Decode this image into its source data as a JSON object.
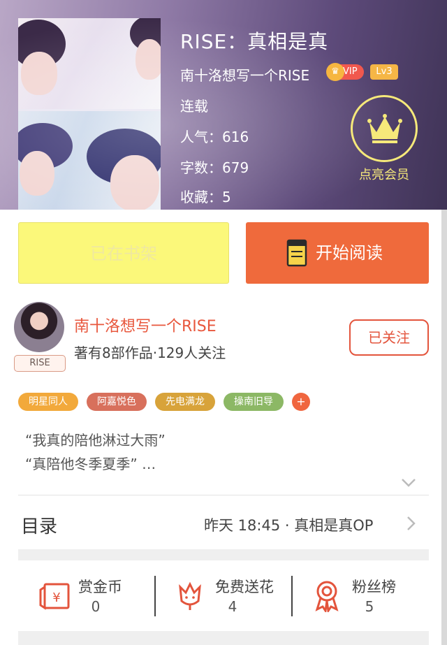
{
  "book": {
    "title": "RISE：真相是真",
    "author": "南十洛想写一个RISE",
    "vip_label": "VIP",
    "vip_crown": "♛",
    "level": "Lv3",
    "status": "连载",
    "popularity": "人气：616",
    "word_count": "字数：679",
    "favorites": "收藏：5",
    "member_label": "点亮会员"
  },
  "actions": {
    "shelf_label": "已在书架",
    "read_label": "开始阅读"
  },
  "author_card": {
    "name": "南十洛想写一个RISE",
    "stats": "著有8部作品·129人关注",
    "avatar_tag": "RISE",
    "follow_label": "已关注"
  },
  "tags": [
    {
      "label": "明星同人",
      "color": "#f2a93b"
    },
    {
      "label": "阿嘉悦色",
      "color": "#d8705c"
    },
    {
      "label": "先电满龙",
      "color": "#d8a33a"
    },
    {
      "label": "操南旧导",
      "color": "#8cb865"
    }
  ],
  "tag_more": "+",
  "synopsis": {
    "line1": "“我真的陪他淋过大雨”",
    "line2": "“真陪他冬季夏季” …"
  },
  "catalog": {
    "label": "目录",
    "latest": "昨天 18:45 · 真相是真OP"
  },
  "stats": [
    {
      "label": "赏金币",
      "value": "0",
      "icon": "red-envelope-icon"
    },
    {
      "label": "免费送花",
      "value": "4",
      "icon": "flower-icon"
    },
    {
      "label": "粉丝榜",
      "value": "5",
      "icon": "medal-icon"
    }
  ],
  "colors": {
    "accent": "#ef6a3c",
    "shelf_button": "#fbf87a",
    "member_gold": "#f6e97a",
    "icon_red": "#e3543c"
  }
}
